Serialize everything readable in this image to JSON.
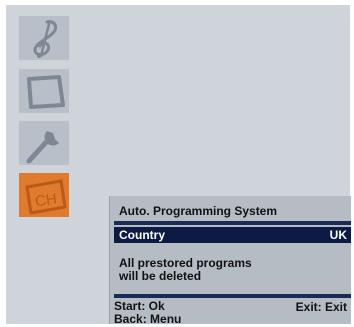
{
  "menu": {
    "icons": [
      {
        "name": "music-clef-icon"
      },
      {
        "name": "picture-icon"
      },
      {
        "name": "wrench-icon"
      },
      {
        "name": "channel-icon",
        "label": "CH",
        "selected": true
      }
    ]
  },
  "dialog": {
    "title": "Auto. Programming System",
    "country_label": "Country",
    "country_value": "UK",
    "warning_line1": "All prestored programs",
    "warning_line2": "will be deleted",
    "start_hint": "Start: Ok",
    "back_hint": "Back: Menu",
    "exit_hint": "Exit: Exit"
  },
  "colors": {
    "screen_bg": "#cfd4db",
    "tile_bg": "#b8bfc8",
    "selected_tile": "#e07a2c",
    "highlight_row": "#0d1a44",
    "dialog_bg": "#b6bcc4"
  }
}
